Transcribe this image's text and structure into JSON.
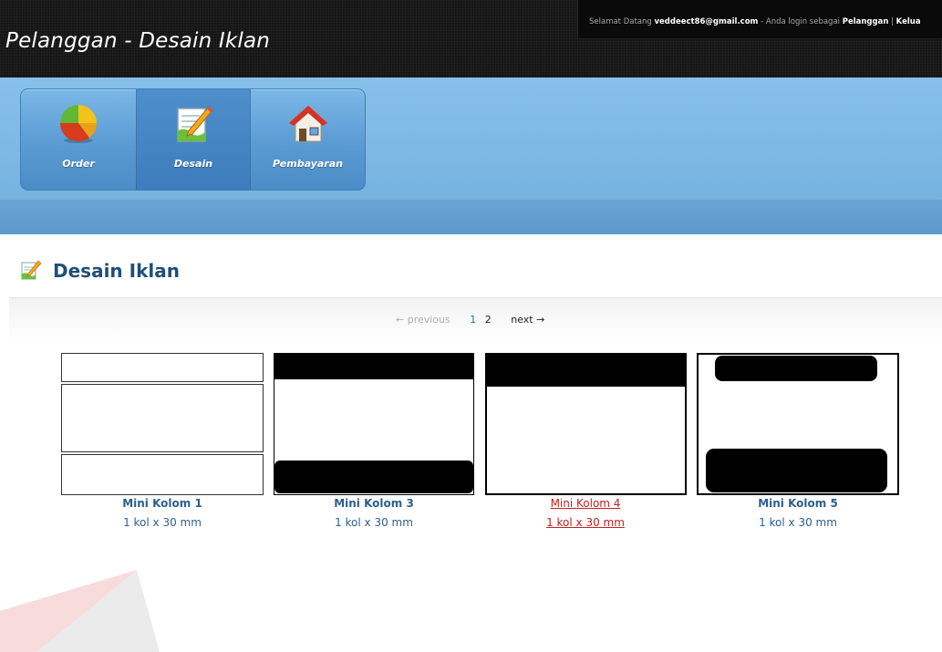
{
  "header": {
    "title": "Pelanggan - Desain Iklan",
    "welcome_prefix": "Selamat Datang",
    "user_email": "veddeect86@gmail.com",
    "login_text": "- Anda login sebagai",
    "role": "Pelanggan",
    "separator": "|",
    "logout": "Kelua"
  },
  "nav": {
    "items": [
      {
        "label": "Order",
        "icon": "pie-chart-icon"
      },
      {
        "label": "Desain",
        "icon": "pencil-document-icon",
        "active": true
      },
      {
        "label": "Pembayaran",
        "icon": "house-icon"
      }
    ]
  },
  "page": {
    "title": "Desain Iklan",
    "icon": "pencil-document-icon"
  },
  "pagination": {
    "previous": "← previous",
    "pages": [
      "1",
      "2"
    ],
    "current": "2",
    "next": "next →"
  },
  "designs": [
    {
      "name": "Mini Kolom 1",
      "size": "1 kol x 30 mm"
    },
    {
      "name": "Mini Kolom 3",
      "size": "1 kol x 30 mm"
    },
    {
      "name": "Mini Kolom 4",
      "size": "1 kol x 30 mm",
      "hovered": true
    },
    {
      "name": "Mini Kolom 5",
      "size": "1 kol x 30 mm"
    }
  ],
  "colors": {
    "header_bg": "#151515",
    "nav_blue": "#7cb8e7",
    "title_blue": "#1f4f77",
    "link_blue": "#2d5f8e",
    "hover_red": "#c42020"
  }
}
